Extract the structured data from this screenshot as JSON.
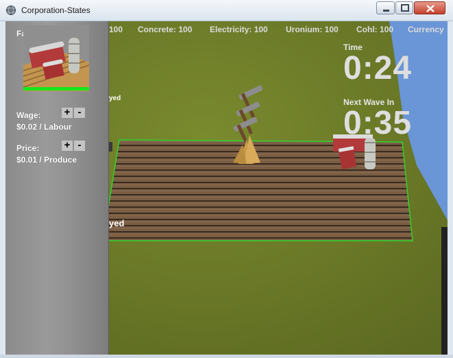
{
  "window": {
    "title": "Corporation-States",
    "icon": "app-icon",
    "minimize_icon": "minimize-icon",
    "maximize_icon": "maximize-icon",
    "close_icon": "close-icon"
  },
  "resources": [
    {
      "text": "100"
    },
    {
      "text": "Concrete: 100"
    },
    {
      "text": "Electricity: 100"
    },
    {
      "text": "Uronium: 100"
    },
    {
      "text": "Cohl: 100"
    },
    {
      "text": "Currency"
    }
  ],
  "panel": {
    "title": "Farm",
    "health_fraction": 1.0,
    "health_color": "#19e619",
    "wage_label": "Wage:",
    "wage_value": "$0.02 / Labour",
    "price_label": "Price:",
    "price_value": "$0.01 / Produce",
    "plus": "+",
    "minus": "-"
  },
  "timers": {
    "time_label": "Time",
    "time_value": "0:24",
    "wave_label": "Next Wave In",
    "wave_value": "0:35"
  },
  "world_labels": {
    "top": "yed",
    "bottom": "yed"
  },
  "colors": {
    "selection_outline": "#2bd62b",
    "water": "#6a95d6",
    "grass": "#6b7a26"
  }
}
